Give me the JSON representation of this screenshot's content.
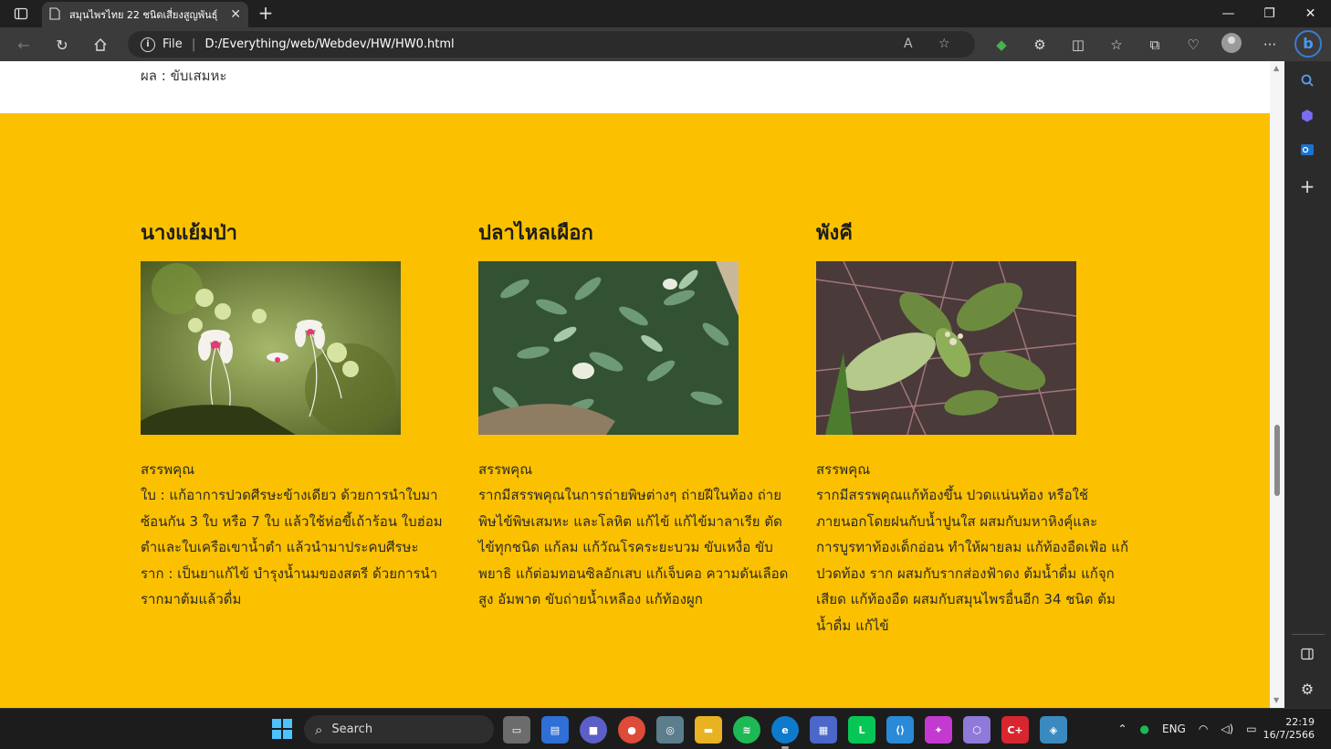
{
  "browser": {
    "tab_title": "สมุนไพรไทย 22 ชนิดเสี่ยงสูญพันธุ์",
    "address_scheme": "File",
    "address_url": "D:/Everything/web/Webdev/HW/HW0.html"
  },
  "page": {
    "top_remnant": "ผล : ขับเสมหะ",
    "cards": [
      {
        "title": "นางแย้มป่า",
        "label": "สรรพคุณ",
        "paragraphs": [
          "ใบ : แก้อาการปวดศีรษะข้างเดียว ด้วยการนำใบมาซ้อนกัน 3 ใบ หรือ 7 ใบ แล้วใช้ห่อขี้เถ้าร้อน ใบฮ่อมตำและใบเครือเขาน้ำตำ แล้วนำมาประคบศีรษะ",
          "ราก : เป็นยาแก้ไข้ บำรุงน้ำนมของสตรี ด้วยการนำรากมาต้มแล้วดื่ม"
        ]
      },
      {
        "title": "ปลาไหลเผือก",
        "label": "สรรพคุณ",
        "paragraphs": [
          "รากมีสรรพคุณในการถ่ายพิษต่างๆ ถ่ายฝีในท้อง ถ่ายพิษไข้พิษเสมหะ และโลหิต แก้ไข้ แก้ไข้มาลาเรีย ตัดไข้ทุกชนิด แก้ลม แก้วัณโรคระยะบวม ขับเหงื่อ ขับพยาธิ แก้ต่อมทอนซิลอักเสบ แก้เจ็บคอ ความดันเลือดสูง อัมพาต ขับถ่ายน้ำเหลือง แก้ท้องผูก"
        ]
      },
      {
        "title": "พังคี",
        "label": "สรรพคุณ",
        "paragraphs": [
          "รากมีสรรพคุณแก้ท้องขึ้น ปวดแน่นท้อง หรือใช้ภายนอกโดยฝนกับน้ำปูนใส ผสมกับมหาหิงคุ์และการบูรทาท้องเด็กอ่อน ทำให้ผายลม แก้ท้องอืดเฟ้อ แก้ปวดท้อง ราก ผสมกับรากส่องฟ้าดง ต้มน้ำดื่ม แก้จุกเสียด แก้ท้องอืด ผสมกับสมุนไพรอื่นอีก 34 ชนิด ต้มน้ำดื่ม แก้ไข้"
        ]
      }
    ]
  },
  "taskbar": {
    "search_label": "Search",
    "language": "ENG",
    "time": "22:19",
    "date": "16/7/2566"
  },
  "colors": {
    "section_bg": "#fbc100",
    "accent": "#4cc2ff"
  }
}
